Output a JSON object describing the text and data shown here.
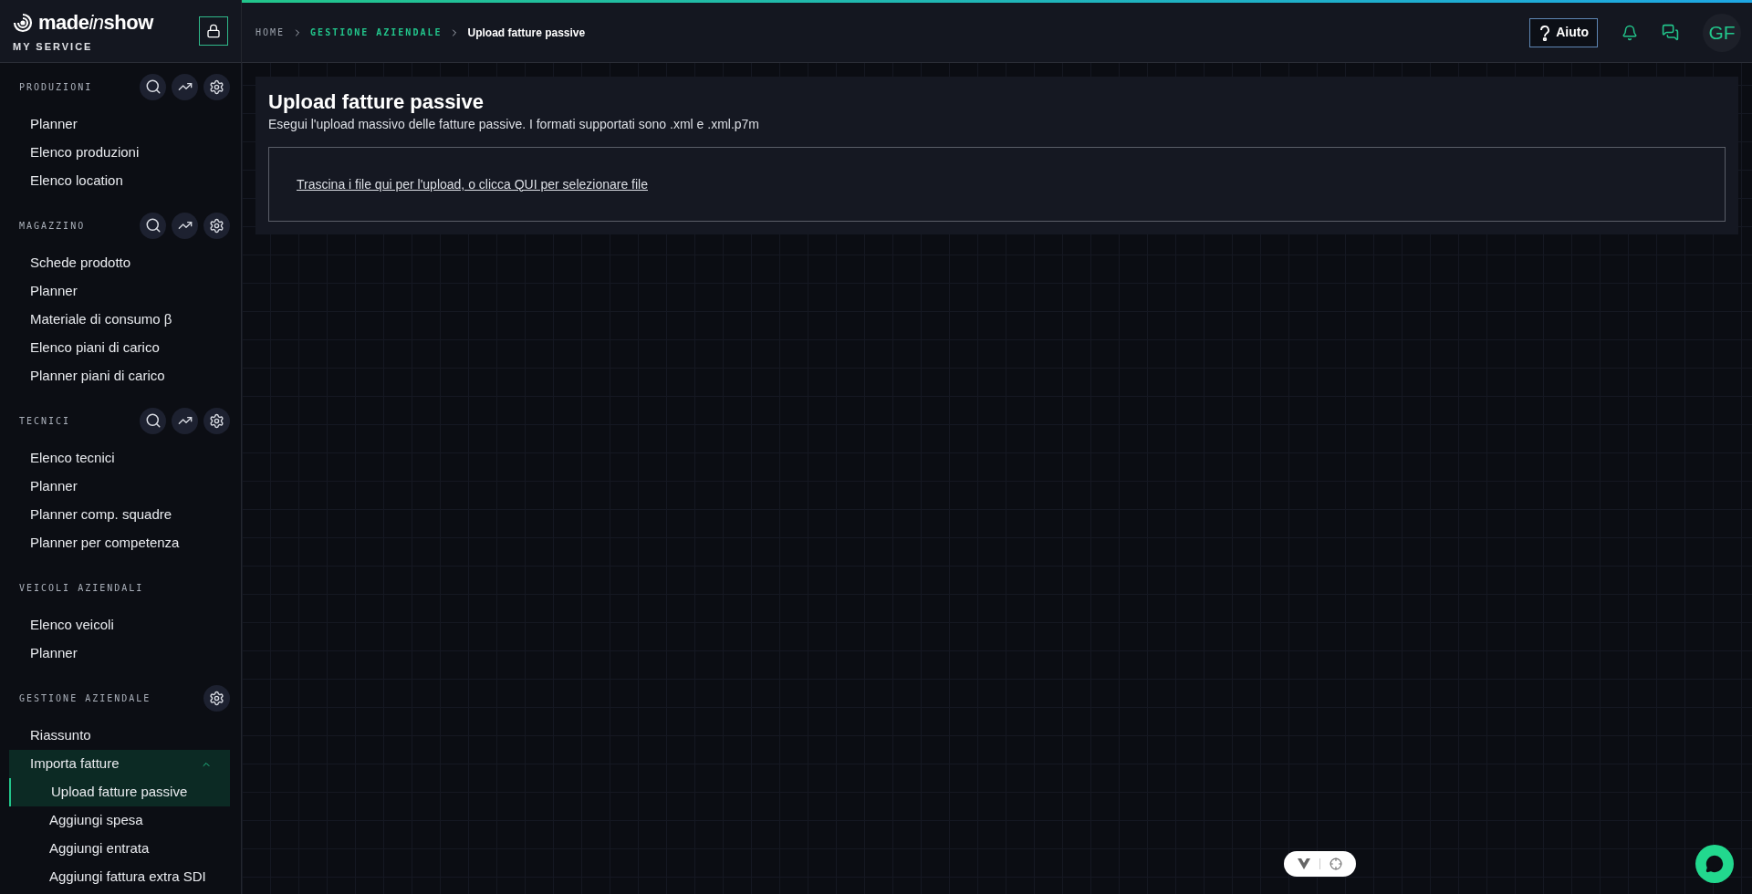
{
  "brand": {
    "logo": [
      "made",
      "in",
      "show"
    ],
    "subtitle": "MY SERVICE"
  },
  "sidebar": {
    "sections": [
      {
        "title": "PRODUZIONI",
        "actions": [
          {
            "kind": "search"
          },
          {
            "kind": "chart"
          },
          {
            "kind": "settings"
          }
        ],
        "items": [
          {
            "label": "Planner",
            "selected": false
          },
          {
            "label": "Elenco produzioni",
            "selected": false
          },
          {
            "label": "Elenco location",
            "selected": false
          }
        ]
      },
      {
        "title": "MAGAZZINO",
        "actions": [
          {
            "kind": "search"
          },
          {
            "kind": "chart"
          },
          {
            "kind": "settings"
          }
        ],
        "items": [
          {
            "label": "Schede prodotto",
            "selected": false
          },
          {
            "label": "Planner",
            "selected": false
          },
          {
            "label": "Materiale di consumo β",
            "selected": false
          },
          {
            "label": "Elenco piani di carico",
            "selected": false
          },
          {
            "label": "Planner piani di carico",
            "selected": false
          }
        ]
      },
      {
        "title": "TECNICI",
        "actions": [
          {
            "kind": "search"
          },
          {
            "kind": "chart"
          },
          {
            "kind": "settings"
          }
        ],
        "items": [
          {
            "label": "Elenco tecnici",
            "selected": false
          },
          {
            "label": "Planner",
            "selected": false
          },
          {
            "label": "Planner comp. squadre",
            "selected": false
          },
          {
            "label": "Planner per competenza",
            "selected": false
          }
        ]
      },
      {
        "title": "VEICOLI AZIENDALI",
        "items": [
          {
            "label": "Elenco veicoli",
            "selected": false
          },
          {
            "label": "Planner",
            "selected": false
          }
        ]
      },
      {
        "title": "GESTIONE AZIENDALE",
        "actions": [
          {
            "kind": "settings"
          }
        ],
        "items": [
          {
            "label": "Riassunto",
            "selected": false
          },
          {
            "label": "Importa fatture",
            "selected": false,
            "expanded": true,
            "children": [
              {
                "label": "Upload fatture passive",
                "selected": true
              },
              {
                "label": "Aggiungi spesa",
                "selected": false
              },
              {
                "label": "Aggiungi entrata",
                "selected": false
              },
              {
                "label": "Aggiungi fattura extra SDI",
                "selected": false
              }
            ]
          }
        ]
      }
    ]
  },
  "breadcrumb": [
    {
      "label": "HOME",
      "kind": "root"
    },
    {
      "label": "GESTIONE AZIENDALE",
      "kind": "section"
    },
    {
      "label": "Upload fatture passive",
      "kind": "current"
    }
  ],
  "header": {
    "help": "Aiuto",
    "avatar": "GF"
  },
  "page": {
    "title": "Upload fatture passive",
    "description": "Esegui l'upload massivo delle fatture passive. I formati supportati sono .xml e .xml.p7m",
    "dropzone": "Trascina i file qui per l'upload, o clicca QUI per selezionare file"
  }
}
